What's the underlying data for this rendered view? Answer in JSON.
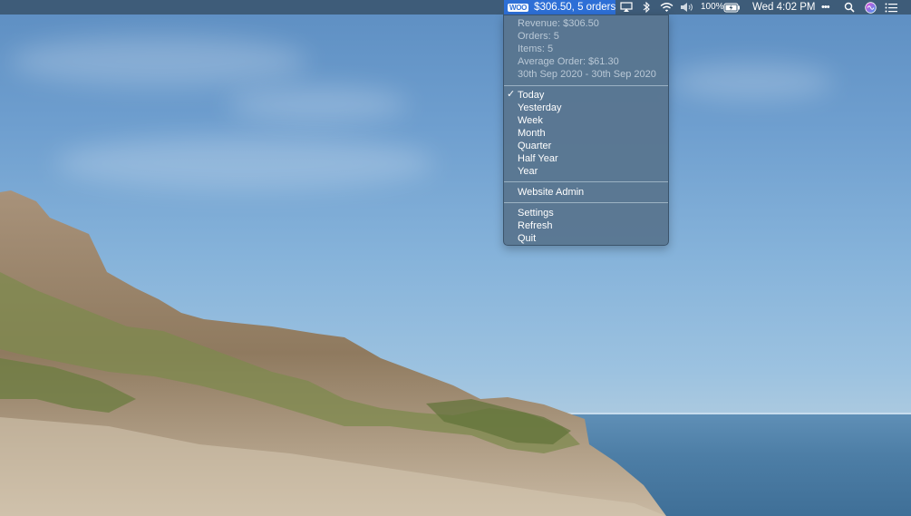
{
  "menubar": {
    "app_status": "$306.50, 5 orders",
    "app_logo_text": "WOO",
    "battery": "100%",
    "clock": "Wed 4:02 PM",
    "overflow": "•••"
  },
  "menu": {
    "info": [
      "Revenue: $306.50",
      "Orders: 5",
      "Items: 5",
      "Average Order: $61.30",
      "30th Sep 2020 - 30th Sep 2020"
    ],
    "periods": [
      "Today",
      "Yesterday",
      "Week",
      "Month",
      "Quarter",
      "Half Year",
      "Year"
    ],
    "selected_period": "Today",
    "checkmark": "✓",
    "admin": "Website Admin",
    "actions": [
      "Settings",
      "Refresh",
      "Quit"
    ]
  },
  "colors": {
    "menubar_highlight": "#2d6fd6",
    "menu_bg": "#58748e",
    "disabled_text": "#b9c8d6"
  }
}
